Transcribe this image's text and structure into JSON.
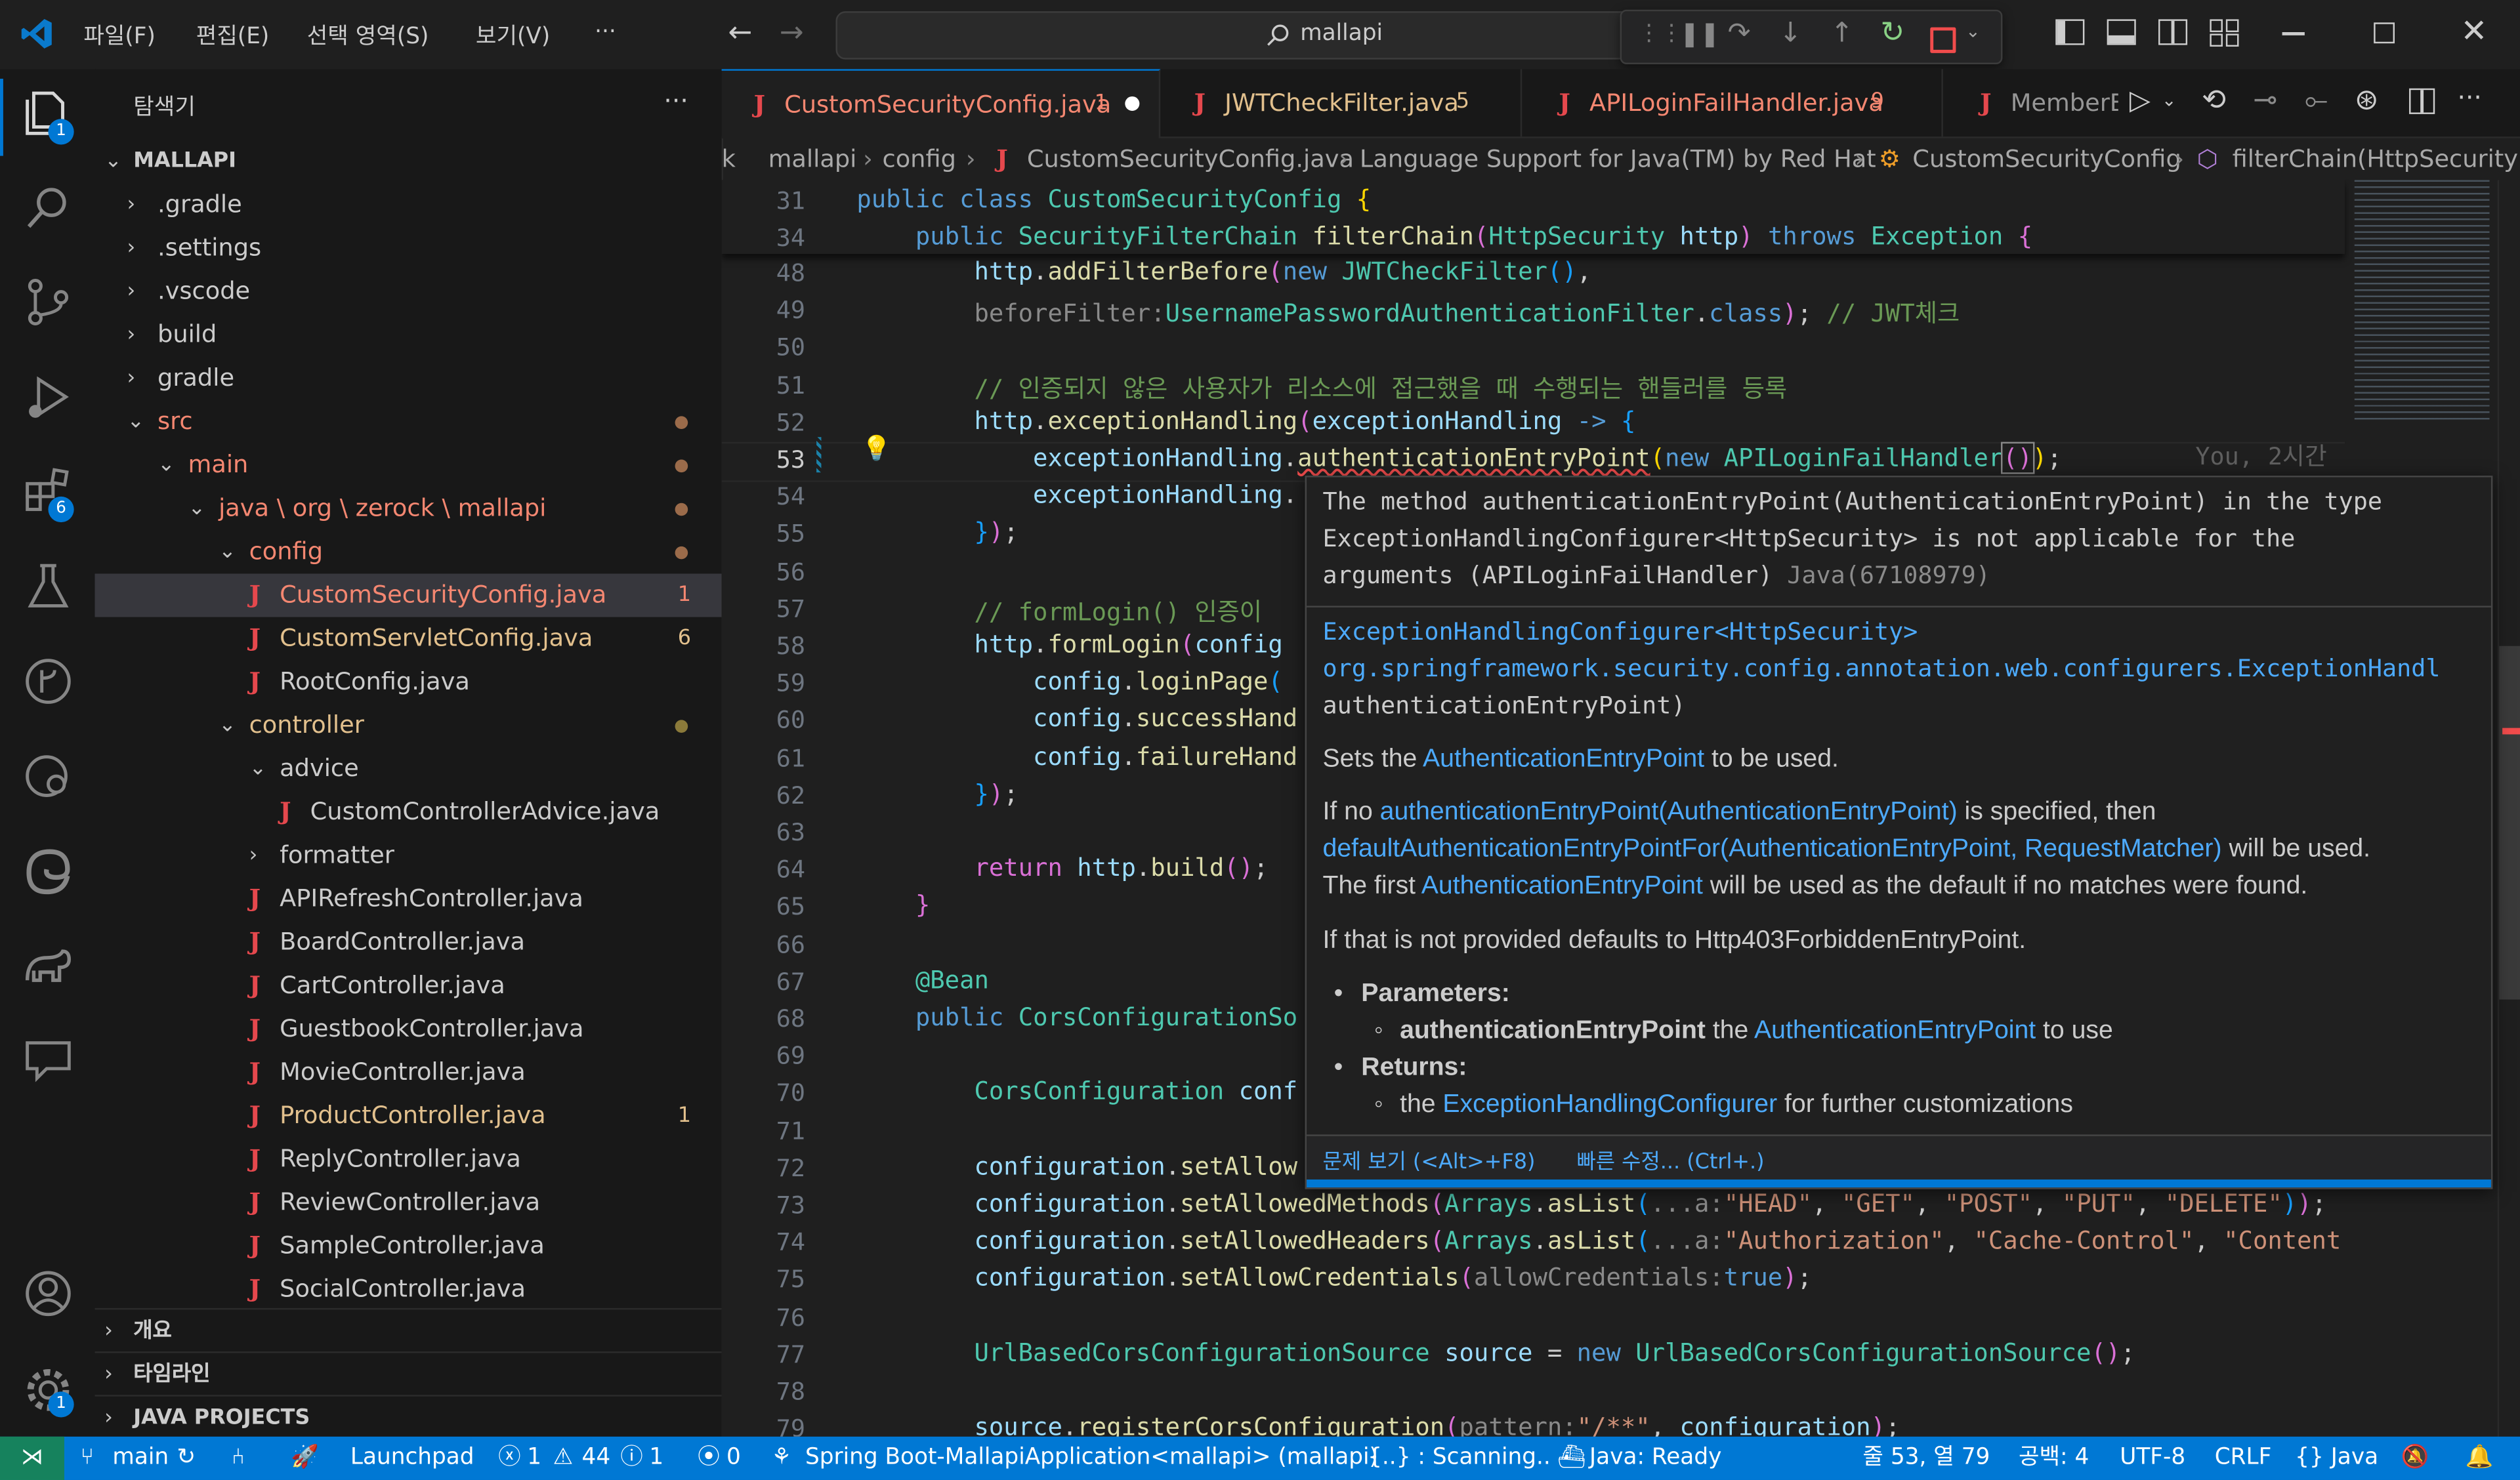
{
  "title_bar": {
    "menus": [
      "파일(F)",
      "편집(E)",
      "선택 영역(S)",
      "보기(V)",
      "···"
    ],
    "search_text": "mallapi"
  },
  "activity_bar": {
    "icons": [
      "explorer-icon",
      "search-icon",
      "source-control-icon",
      "run-debug-icon",
      "extensions-icon",
      "testing-icon",
      "git-graph-icon",
      "docker-icon",
      "edge-icon",
      "gradle-icon",
      "chat-icon",
      "account-icon",
      "settings-icon"
    ],
    "explorer_badge": "1",
    "extensions_badge": "6",
    "settings_badge": "1"
  },
  "sidebar": {
    "title": "탐색기",
    "more": "···",
    "root": "MALLAPI",
    "items": [
      {
        "label": ".gradle",
        "type": "folder"
      },
      {
        "label": ".settings",
        "type": "folder"
      },
      {
        "label": ".vscode",
        "type": "folder"
      },
      {
        "label": "build",
        "type": "folder"
      },
      {
        "label": "gradle",
        "type": "folder"
      },
      {
        "label": "src",
        "type": "folder-open"
      },
      {
        "label": "main",
        "type": "folder-open"
      },
      {
        "label": "java \\ org \\ zerock \\ mallapi",
        "type": "folder-open"
      },
      {
        "label": "config",
        "type": "folder-open"
      },
      {
        "label": "CustomSecurityConfig.java",
        "type": "file",
        "count": "1"
      },
      {
        "label": "CustomServletConfig.java",
        "type": "file",
        "count": "6"
      },
      {
        "label": "RootConfig.java",
        "type": "file"
      },
      {
        "label": "controller",
        "type": "folder-open"
      },
      {
        "label": "advice",
        "type": "folder-open"
      },
      {
        "label": "CustomControllerAdvice.java",
        "type": "file"
      },
      {
        "label": "formatter",
        "type": "folder"
      },
      {
        "label": "APIRefreshController.java",
        "type": "file"
      },
      {
        "label": "BoardController.java",
        "type": "file"
      },
      {
        "label": "CartController.java",
        "type": "file"
      },
      {
        "label": "GuestbookController.java",
        "type": "file"
      },
      {
        "label": "MovieController.java",
        "type": "file"
      },
      {
        "label": "ProductController.java",
        "type": "file",
        "count": "1"
      },
      {
        "label": "ReplyController.java",
        "type": "file"
      },
      {
        "label": "ReviewController.java",
        "type": "file"
      },
      {
        "label": "SampleController.java",
        "type": "file"
      },
      {
        "label": "SocialController.java",
        "type": "file"
      }
    ],
    "sections": [
      "개요",
      "타임라인",
      "JAVA PROJECTS"
    ]
  },
  "tabs": [
    {
      "label": "CustomSecurityConfig.java",
      "count": "1"
    },
    {
      "label": "JWTCheckFilter.java",
      "count": "5"
    },
    {
      "label": "APILoginFailHandler.java",
      "count": "9"
    },
    {
      "label": "MemberE",
      "count": ""
    }
  ],
  "breadcrumb": [
    "k",
    "mallapi",
    "config",
    "CustomSecurityConfig.java",
    "Language Support for Java(TM) by Red Hat",
    "CustomSecurityConfig",
    "filterChain(HttpSecurity)"
  ],
  "editor": {
    "line_numbers": [
      "31",
      "34",
      "48",
      "49",
      "50",
      "51",
      "52",
      "53",
      "54",
      "55",
      "56",
      "57",
      "58",
      "59",
      "60",
      "61",
      "62",
      "63",
      "64",
      "65",
      "66",
      "67",
      "68",
      "69",
      "70",
      "71",
      "72",
      "73",
      "74",
      "75",
      "76",
      "77",
      "78",
      "79"
    ],
    "blame": "You, 2시간",
    "comment_51": "// 인증되지 않은 사용자가 리소스에 접근했을 때 수행되는 핸들러를 등록",
    "comment_57": "// formLogin() 인증이",
    "comment_49": "// JWT체크"
  },
  "hover": {
    "error_line1": "The method authenticationEntryPoint(AuthenticationEntryPoint) in the type",
    "error_line2": "ExceptionHandlingConfigurer<HttpSecurity> is not applicable for the",
    "error_line3": "arguments (APILoginFailHandler)",
    "error_code": "Java(67108979)",
    "sig_line1": "ExceptionHandlingConfigurer<HttpSecurity>",
    "sig_line2": "org.springframework.security.config.annotation.web.configurers.ExceptionHandl",
    "sig_line3": "authenticationEntryPoint)",
    "doc1_a": "Sets the ",
    "doc1_link": "AuthenticationEntryPoint",
    "doc1_b": " to be used.",
    "doc2_a": "If no ",
    "doc2_link": "authenticationEntryPoint(AuthenticationEntryPoint)",
    "doc2_b": " is specified, then",
    "doc3_link": "defaultAuthenticationEntryPointFor(AuthenticationEntryPoint, RequestMatcher)",
    "doc3_b": " will be used.",
    "doc4_a": "The first ",
    "doc4_link": "AuthenticationEntryPoint",
    "doc4_b": " will be used as the default if no matches were found.",
    "doc5": "If that is not provided defaults to Http403ForbiddenEntryPoint.",
    "params_label": "Parameters:",
    "param_name": "authenticationEntryPoint",
    "param_a": " the ",
    "param_link": "AuthenticationEntryPoint",
    "param_b": " to use",
    "returns_label": "Returns:",
    "returns_a": "the ",
    "returns_link": "ExceptionHandlingConfigurer",
    "returns_b": " for further customizations",
    "action_problem": "문제 보기 (<Alt>+F8)",
    "action_fix": "빠른 수정... (Ctrl+.)"
  },
  "status_bar": {
    "branch": "main",
    "launchpad": "Launchpad",
    "errors": "1",
    "warnings": "44",
    "info": "1",
    "ports": "0",
    "app": "Spring Boot-MallapiApplication<mallapi> (mallapi)",
    "scanning": "{..} : Scanning..",
    "java_ready": "Java: Ready",
    "position": "줄 53, 열 79",
    "spaces": "공백: 4",
    "encoding": "UTF-8",
    "eol": "CRLF",
    "language": "{} Java"
  },
  "colors": {
    "accent": "#0078d4",
    "error": "#f14c4c",
    "modified_file": "#e2c08d",
    "error_file": "#f48771"
  }
}
